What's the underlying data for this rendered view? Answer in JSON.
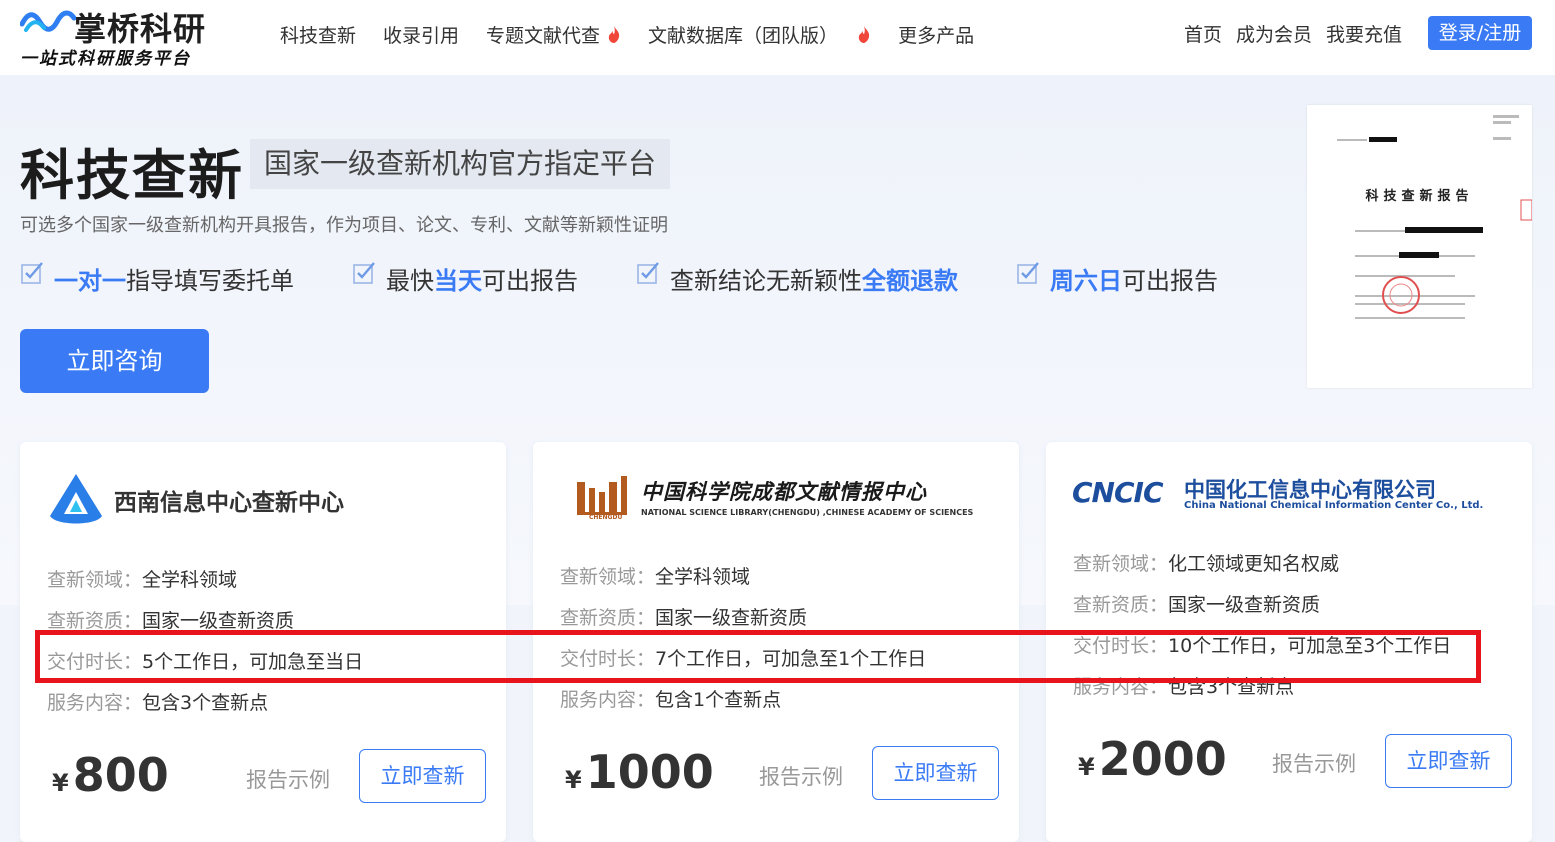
{
  "brand": {
    "name": "掌桥科研",
    "slogan": "一站式科研服务平台"
  },
  "nav": {
    "items": [
      "科技查新",
      "收录引用",
      "专题文献代查",
      "文献数据库（团队版）",
      "更多产品"
    ],
    "right": [
      "首页",
      "成为会员",
      "我要充值"
    ],
    "login": "登录/注册"
  },
  "hero": {
    "title": "科技查新",
    "tag": "国家一级查新机构官方指定平台",
    "desc": "可选多个国家一级查新机构开具报告，作为项目、论文、专利、文献等新颖性证明",
    "features": [
      {
        "pre": "",
        "em": "一对一",
        "post": "指导填写委托单"
      },
      {
        "pre": "最快",
        "em": "当天",
        "post": "可出报告"
      },
      {
        "pre": "查新结论无新颖性",
        "em": "全额退款",
        "post": ""
      },
      {
        "pre": "",
        "em": "周六日",
        "post": "可出报告"
      }
    ],
    "consult_button": "立即咨询",
    "report_title": "科技查新报告"
  },
  "cards": [
    {
      "org": "西南信息中心查新中心",
      "field_label": "查新领域：",
      "field": "全学科领域",
      "qual_label": "查新资质：",
      "qual": "国家一级查新资质",
      "time_label": "交付时长：",
      "time": "5个工作日，可加急至当日",
      "service_label": "服务内容：",
      "service": "包含3个查新点",
      "currency": "¥",
      "price": "800",
      "sample": "报告示例",
      "button": "立即查新"
    },
    {
      "org": "中国科学院成都文献情报中心",
      "org_en": "NATIONAL SCIENCE LIBRARY(CHENGDU) ,CHINESE ACADEMY OF SCIENCES",
      "org_tag": "CHENGDU",
      "field_label": "查新领域：",
      "field": "全学科领域",
      "qual_label": "查新资质：",
      "qual": "国家一级查新资质",
      "time_label": "交付时长：",
      "time": "7个工作日，可加急至1个工作日",
      "service_label": "服务内容：",
      "service": "包含1个查新点",
      "currency": "¥",
      "price": "1000",
      "sample": "报告示例",
      "button": "立即查新"
    },
    {
      "org": "中国化工信息中心有限公司",
      "org_en": "China National Chemical Information Center Co., Ltd.",
      "org_mark": "CNCIC",
      "field_label": "查新领域：",
      "field": "化工领域更知名权威",
      "qual_label": "查新资质：",
      "qual": "国家一级查新资质",
      "time_label": "交付时长：",
      "time": "10个工作日，可加急至3个工作日",
      "service_label": "服务内容：",
      "service": "包含3个查新点",
      "currency": "¥",
      "price": "2000",
      "sample": "报告示例",
      "button": "立即查新"
    }
  ],
  "colors": {
    "accent": "#3a7bf5",
    "highlight": "#e8141c",
    "fire": "#f0473a"
  }
}
